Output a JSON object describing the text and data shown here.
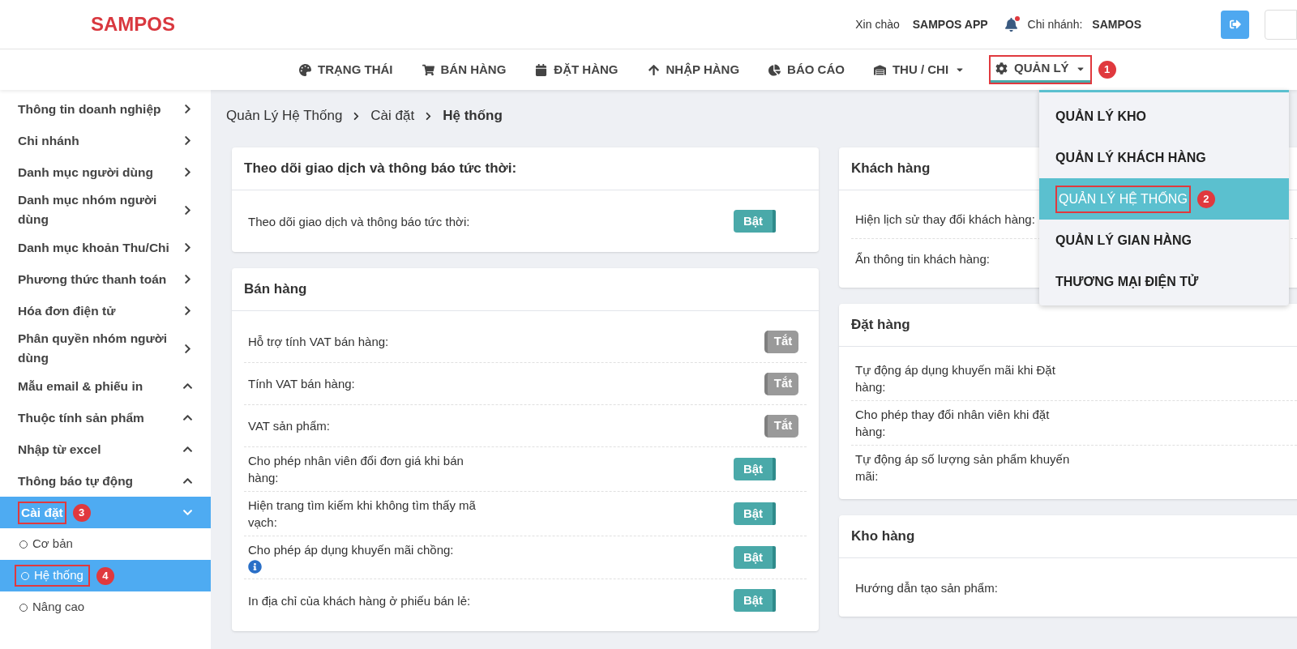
{
  "header": {
    "logo": "SAMPOS",
    "greeting": "Xin chào",
    "user": "SAMPOS APP",
    "notification_dot": true,
    "branch_label": "Chi nhánh:",
    "branch": "SAMPOS"
  },
  "nav": [
    {
      "label": "TRẠNG THÁI",
      "selected": false,
      "has_menu": false
    },
    {
      "label": "BÁN HÀNG",
      "selected": false,
      "has_menu": false
    },
    {
      "label": "ĐẶT HÀNG",
      "selected": false,
      "has_menu": false
    },
    {
      "label": "NHẬP HÀNG",
      "selected": false,
      "has_menu": false
    },
    {
      "label": "BÁO CÁO",
      "selected": false,
      "has_menu": false
    },
    {
      "label": "THU / CHI",
      "selected": false,
      "has_menu": true
    },
    {
      "label": "QUẢN LÝ",
      "selected": true,
      "has_menu": true,
      "callout": "1"
    }
  ],
  "dropdown": [
    {
      "label": "QUẢN LÝ KHO",
      "selected": false
    },
    {
      "label": "QUẢN LÝ KHÁCH HÀNG",
      "selected": false
    },
    {
      "label": "QUẢN LÝ HỆ THỐNG",
      "selected": true,
      "callout": "2"
    },
    {
      "label": "QUẢN LÝ GIAN HÀNG",
      "selected": false
    },
    {
      "label": "THƯƠNG MẠI ĐIỆN TỬ",
      "selected": false
    }
  ],
  "sidebar": [
    {
      "label": "Thông tin doanh nghiệp",
      "kind": "link",
      "selected": false
    },
    {
      "label": "Chi nhánh",
      "kind": "link",
      "selected": false
    },
    {
      "label": "Danh mục người dùng",
      "kind": "link",
      "selected": false
    },
    {
      "label": "Danh mục nhóm người dùng",
      "kind": "link",
      "selected": false
    },
    {
      "label": "Danh mục khoản Thu/Chi",
      "kind": "link",
      "selected": false
    },
    {
      "label": "Phương thức thanh toán",
      "kind": "link",
      "selected": false
    },
    {
      "label": "Hóa đơn điện tử",
      "kind": "link",
      "selected": false
    },
    {
      "label": "Phân quyền nhóm người dùng",
      "kind": "link",
      "selected": false
    },
    {
      "label": "Mẫu email & phiếu in",
      "kind": "group",
      "expanded": false,
      "selected": false
    },
    {
      "label": "Thuộc tính sản phẩm",
      "kind": "group",
      "expanded": false,
      "selected": false
    },
    {
      "label": "Nhập từ excel",
      "kind": "group",
      "expanded": false,
      "selected": false
    },
    {
      "label": "Thông báo tự động",
      "kind": "group",
      "expanded": false,
      "selected": false
    },
    {
      "label": "Cài đặt",
      "kind": "group",
      "expanded": true,
      "selected": true,
      "callout": "3",
      "children": [
        {
          "label": "Cơ bản",
          "selected": false
        },
        {
          "label": "Hệ thống",
          "selected": true,
          "callout": "4"
        },
        {
          "label": "Nâng cao",
          "selected": false
        }
      ]
    }
  ],
  "breadcrumb": [
    "Quản Lý Hệ Thống",
    "Cài đặt",
    "Hệ thống"
  ],
  "left_cards": [
    {
      "title": "Theo dõi giao dịch và thông báo tức thời:",
      "rows": [
        {
          "label": "Theo dõi giao dịch và thông báo tức thời:",
          "toggle": "Bật",
          "on": true
        }
      ]
    },
    {
      "title": "Bán hàng",
      "rows": [
        {
          "label": "Hỗ trợ tính VAT bán hàng:",
          "toggle": "Tắt",
          "on": false
        },
        {
          "label": "Tính VAT bán hàng:",
          "toggle": "Tắt",
          "on": false
        },
        {
          "label": "VAT sản phẩm:",
          "toggle": "Tắt",
          "on": false
        },
        {
          "label": "Cho phép nhân viên đổi đơn giá khi bán hàng:",
          "toggle": "Bật",
          "on": true
        },
        {
          "label": "Hiện trang tìm kiếm khi không tìm thấy mã vạch:",
          "toggle": "Bật",
          "on": true
        },
        {
          "label": "Cho phép áp dụng khuyến mãi chồng:",
          "toggle": "Bật",
          "on": true,
          "info": true
        },
        {
          "label": "In địa chỉ của khách hàng ở phiếu bán lẻ:",
          "toggle": "Bật",
          "on": true
        }
      ]
    }
  ],
  "right_cards": [
    {
      "title": "Khách hàng",
      "rows": [
        {
          "label": "Hiện lịch sử thay đổi khách hàng:"
        },
        {
          "label": "Ẩn thông tin khách hàng:"
        }
      ]
    },
    {
      "title": "Đặt hàng",
      "rows": [
        {
          "label": "Tự động áp dụng khuyến mãi khi Đặt hàng:"
        },
        {
          "label": "Cho phép thay đổi nhân viên khi đặt hàng:"
        },
        {
          "label": "Tự động áp số lượng sản phẩm khuyến mãi:"
        }
      ]
    },
    {
      "title": "Kho hàng",
      "rows": [
        {
          "label": "Hướng dẫn tạo sản phẩm:"
        }
      ]
    }
  ]
}
